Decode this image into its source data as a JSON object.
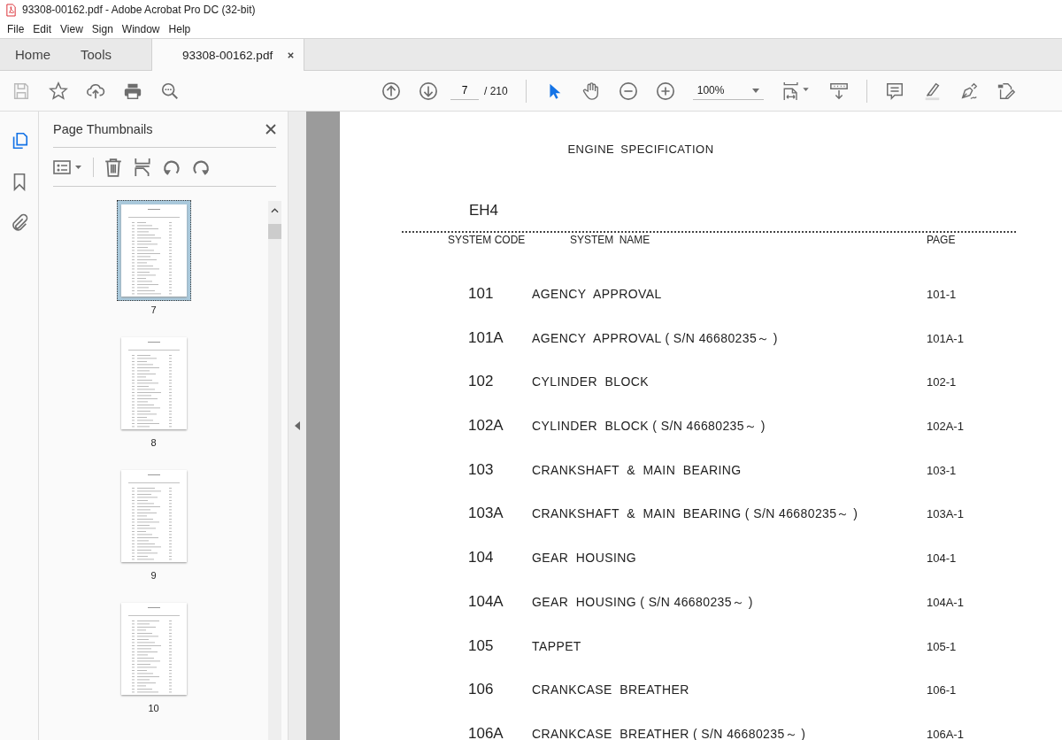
{
  "window": {
    "title": "93308-00162.pdf - Adobe Acrobat Pro DC (32-bit)"
  },
  "menu": [
    "File",
    "Edit",
    "View",
    "Sign",
    "Window",
    "Help"
  ],
  "tabs": [
    {
      "label": "Home",
      "selected": false
    },
    {
      "label": "Tools",
      "selected": false
    },
    {
      "label": "93308-00162.pdf",
      "selected": true,
      "closable": true
    }
  ],
  "toolbar": {
    "save_disabled": true,
    "page_current": "7",
    "page_total": "/ 210",
    "zoom": "100%",
    "tools": [
      {
        "kind": "select",
        "selected": true
      },
      {
        "kind": "hand",
        "selected": false
      }
    ]
  },
  "sidebar": {
    "items": [
      {
        "kind": "pages",
        "selected": true
      },
      {
        "kind": "bookmarks",
        "selected": false
      },
      {
        "kind": "attachments",
        "selected": false
      }
    ]
  },
  "thumbnails_panel": {
    "title": "Page Thumbnails",
    "pages": [
      {
        "label": "7",
        "selected": true
      },
      {
        "label": "8",
        "selected": false
      },
      {
        "label": "9",
        "selected": false
      },
      {
        "label": "10",
        "selected": false
      }
    ]
  },
  "document": {
    "heading": "ENGINE SPECIFICATION",
    "model": "EH4",
    "columns": [
      "SYSTEM CODE",
      "SYSTEM  NAME",
      "PAGE"
    ],
    "rows": [
      {
        "code": "101",
        "name": "AGENCY  APPROVAL",
        "page": "101-1"
      },
      {
        "code": "101A",
        "name": "AGENCY  APPROVAL ( S/N 46680235～ )",
        "page": "101A-1"
      },
      {
        "code": "102",
        "name": "CYLINDER  BLOCK",
        "page": "102-1"
      },
      {
        "code": "102A",
        "name": "CYLINDER  BLOCK ( S/N 46680235～ )",
        "page": "102A-1"
      },
      {
        "code": "103",
        "name": "CRANKSHAFT  &  MAIN  BEARING",
        "page": "103-1"
      },
      {
        "code": "103A",
        "name": "CRANKSHAFT  &  MAIN  BEARING ( S/N 46680235～ )",
        "page": "103A-1"
      },
      {
        "code": "104",
        "name": "GEAR  HOUSING",
        "page": "104-1"
      },
      {
        "code": "104A",
        "name": "GEAR  HOUSING ( S/N 46680235～ )",
        "page": "104A-1"
      },
      {
        "code": "105",
        "name": "TAPPET",
        "page": "105-1"
      },
      {
        "code": "106",
        "name": "CRANKCASE  BREATHER",
        "page": "106-1"
      },
      {
        "code": "106A",
        "name": "CRANKCASE  BREATHER ( S/N 46680235～ )",
        "page": "106A-1"
      }
    ]
  }
}
